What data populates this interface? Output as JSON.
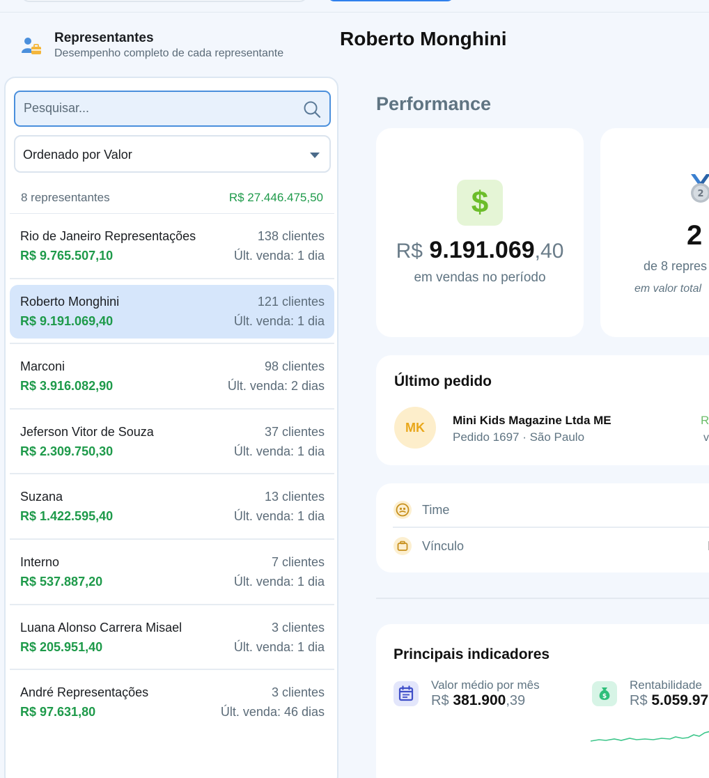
{
  "section": {
    "title": "Representantes",
    "subtitle": "Desempenho completo de cada representante"
  },
  "selected_name": "Roberto Monghini",
  "list": {
    "search_placeholder": "Pesquisar...",
    "sort_label": "Ordenado por Valor",
    "count_label": "8 representantes",
    "total_label": "R$ 27.446.475,50",
    "rows": [
      {
        "name": "Rio de Janeiro Representações",
        "clients": "138 clientes",
        "amount": "R$ 9.765.507,10",
        "last_sale": "Últ. venda: 1 dia"
      },
      {
        "name": "Roberto Monghini",
        "clients": "121 clientes",
        "amount": "R$ 9.191.069,40",
        "last_sale": "Últ. venda: 1 dia"
      },
      {
        "name": "Marconi",
        "clients": "98 clientes",
        "amount": "R$ 3.916.082,90",
        "last_sale": "Últ. venda: 2 dias"
      },
      {
        "name": "Jeferson Vitor de Souza",
        "clients": "37 clientes",
        "amount": "R$ 2.309.750,30",
        "last_sale": "Últ. venda: 1 dia"
      },
      {
        "name": "Suzana",
        "clients": "13 clientes",
        "amount": "R$ 1.422.595,40",
        "last_sale": "Últ. venda: 1 dia"
      },
      {
        "name": "Interno",
        "clients": "7 clientes",
        "amount": "R$ 537.887,20",
        "last_sale": "Últ. venda: 1 dia"
      },
      {
        "name": "Luana Alonso Carrera Misael",
        "clients": "3 clientes",
        "amount": "R$ 205.951,40",
        "last_sale": "Últ. venda: 1 dia"
      },
      {
        "name": "André Representações",
        "clients": "3 clientes",
        "amount": "R$ 97.631,80",
        "last_sale": "Últ. venda: 46 dias"
      }
    ]
  },
  "performance": {
    "title": "Performance",
    "sales": {
      "currency": "R$",
      "integer": "9.191.069",
      "decimal": ",40",
      "caption": "em vendas no período",
      "icon": "dollar-icon"
    },
    "rank": {
      "position": "2",
      "of_label": "de 8 repres",
      "basis_label": "em valor total",
      "icon": "silver-medal-icon"
    }
  },
  "last_order": {
    "title": "Último pedido",
    "avatar_initials": "MK",
    "client": "Mini Kids Magazine Ltda ME",
    "detail": "Pedido 1697 · São Paulo",
    "right_trunc_1": "R",
    "right_trunc_2": "v"
  },
  "info": {
    "team_label": "Time",
    "link_label": "Vínculo",
    "link_trunc": "I"
  },
  "indicators": {
    "title": "Principais indicadores",
    "monthly": {
      "label": "Valor médio por mês",
      "currency": "R$",
      "integer": "381.900",
      "decimal": ",39",
      "icon": "calendar-icon"
    },
    "profit": {
      "label": "Rentabilidade",
      "currency": "R$",
      "integer": "5.059.97",
      "icon": "money-bag-icon"
    }
  },
  "colors": {
    "accent": "#2f80ed",
    "positive": "#1e9a4a",
    "selected_row": "#d6e6fb",
    "muted": "#5f7482"
  }
}
